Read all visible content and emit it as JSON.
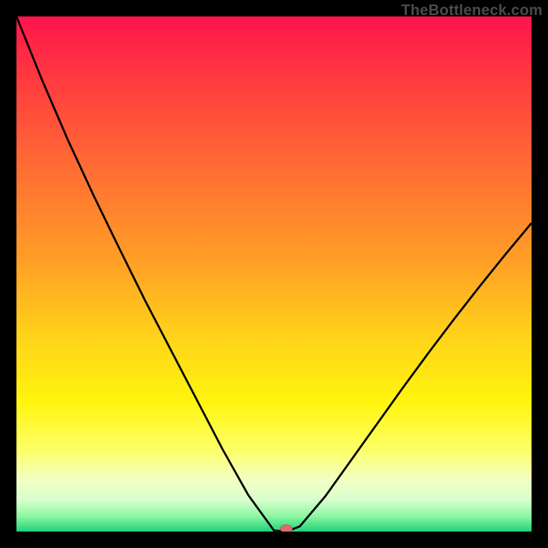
{
  "watermark": "TheBottleneck.com",
  "chart_data": {
    "type": "line",
    "title": "",
    "xlabel": "",
    "ylabel": "",
    "xlim": [
      0,
      100
    ],
    "ylim": [
      0,
      100
    ],
    "grid": false,
    "legend": false,
    "background": {
      "style": "vertical-gradient",
      "stops": [
        {
          "pos": 0.0,
          "color": "#ff144d"
        },
        {
          "pos": 0.12,
          "color": "#ff3a3f"
        },
        {
          "pos": 0.3,
          "color": "#ff6e33"
        },
        {
          "pos": 0.48,
          "color": "#ffa126"
        },
        {
          "pos": 0.62,
          "color": "#ffd21a"
        },
        {
          "pos": 0.75,
          "color": "#fff50e"
        },
        {
          "pos": 0.84,
          "color": "#fdff66"
        },
        {
          "pos": 0.9,
          "color": "#f3ffc4"
        },
        {
          "pos": 0.94,
          "color": "#d6ffcd"
        },
        {
          "pos": 0.97,
          "color": "#8cf7a2"
        },
        {
          "pos": 1.0,
          "color": "#21d07a"
        }
      ]
    },
    "series": [
      {
        "name": "bottleneck-curve",
        "color": "#000000",
        "x": [
          0,
          5,
          10,
          15,
          20,
          25,
          30,
          35,
          40,
          45,
          50,
          52.4,
          55,
          60,
          65,
          70,
          75,
          80,
          85,
          90,
          95,
          100
        ],
        "y": [
          100.0,
          87.6,
          76.0,
          65.2,
          54.9,
          44.8,
          35.2,
          25.6,
          16.0,
          7.1,
          0.2,
          0.0,
          1.0,
          6.9,
          13.9,
          20.9,
          27.9,
          34.7,
          41.3,
          47.7,
          53.9,
          59.9
        ]
      }
    ],
    "marker": {
      "x": 52.4,
      "y": 0.0,
      "color": "#e06a6a"
    }
  }
}
